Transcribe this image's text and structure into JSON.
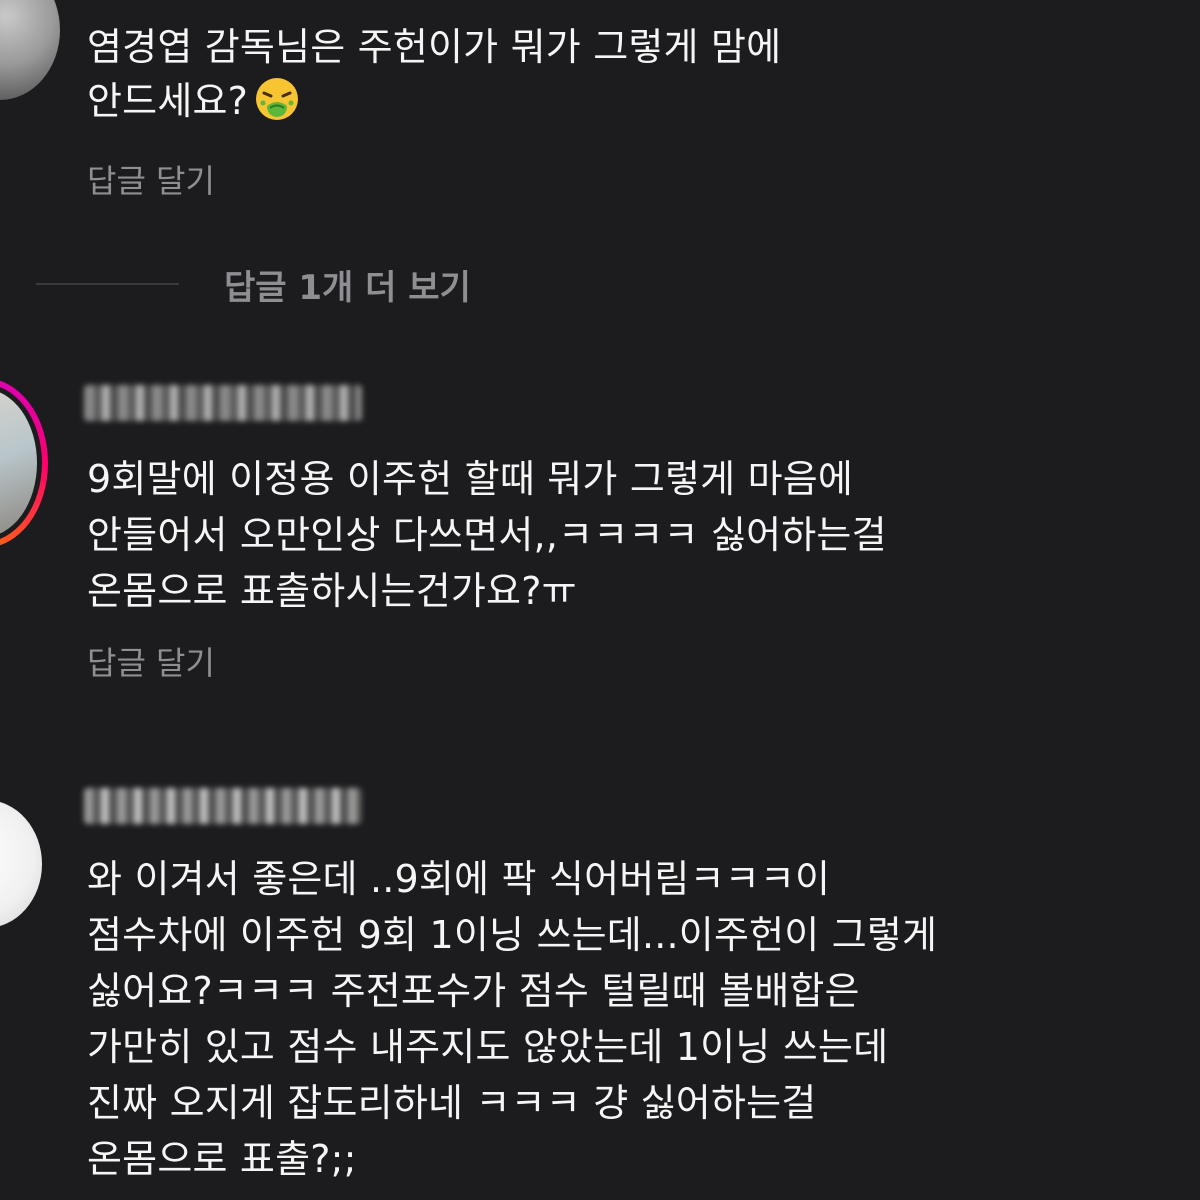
{
  "comments": [
    {
      "lines": [
        "염경엽 감독님은 주헌이가 뭐가 그렇게 맘에",
        "안드세요?"
      ],
      "emoji": "nauseated-face-icon",
      "reply_label": "답글 달기"
    },
    {
      "lines": [
        "9회말에 이정용 이주헌 할때 뭐가 그렇게 마음에",
        "안들어서 오만인상 다쓰면서,,ㅋㅋㅋㅋ 싫어하는걸",
        "온몸으로 표출하시는건가요?ㅠ"
      ],
      "reply_label": "답글 달기"
    },
    {
      "lines": [
        "와 이겨서 좋은데 ..9회에 팍 식어버림ㅋㅋㅋ이",
        "점수차에 이주헌 9회 1이닝 쓰는데...이주헌이 그렇게",
        "싫어요?ㅋㅋㅋ 주전포수가 점수 털릴때 볼배합은",
        "가만히 있고 점수 내주지도 않았는데 1이닝 쓰는데",
        "진짜 오지게 잡도리하네 ㅋㅋㅋ 걍 싫어하는걸",
        "온몸으로 표출?;;"
      ]
    }
  ],
  "more_replies_label": "답글 1개 더 보기",
  "colors": {
    "background": "#1c1c1f",
    "text": "#f5f5f5",
    "muted": "#8e8e93",
    "story_ring": [
      "#d300c5",
      "#ff0069",
      "#ff7a00"
    ]
  }
}
